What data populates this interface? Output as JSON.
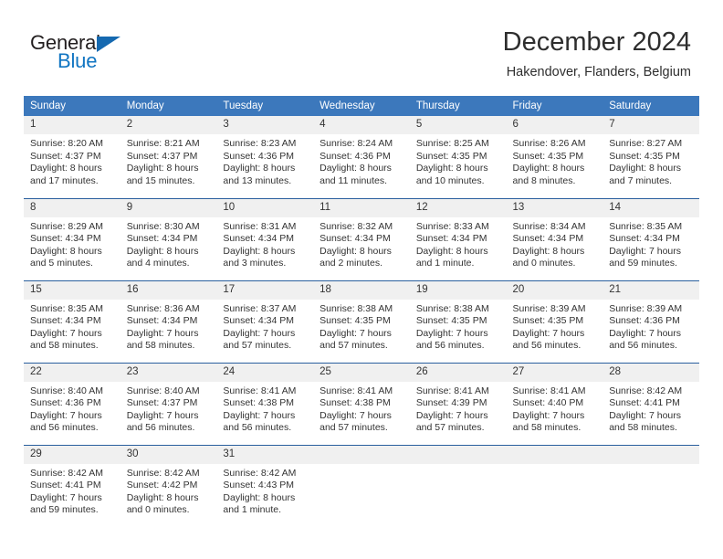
{
  "logo": {
    "word1": "General",
    "word2": "Blue",
    "accent_color": "#1175c2"
  },
  "header": {
    "title": "December 2024",
    "subtitle": "Hakendover, Flanders, Belgium",
    "header_bg": "#3c78bc"
  },
  "calendar": {
    "weekdays": [
      "Sunday",
      "Monday",
      "Tuesday",
      "Wednesday",
      "Thursday",
      "Friday",
      "Saturday"
    ],
    "weeks": [
      [
        {
          "day": "1",
          "sunrise": "Sunrise: 8:20 AM",
          "sunset": "Sunset: 4:37 PM",
          "daylight1": "Daylight: 8 hours",
          "daylight2": "and 17 minutes."
        },
        {
          "day": "2",
          "sunrise": "Sunrise: 8:21 AM",
          "sunset": "Sunset: 4:37 PM",
          "daylight1": "Daylight: 8 hours",
          "daylight2": "and 15 minutes."
        },
        {
          "day": "3",
          "sunrise": "Sunrise: 8:23 AM",
          "sunset": "Sunset: 4:36 PM",
          "daylight1": "Daylight: 8 hours",
          "daylight2": "and 13 minutes."
        },
        {
          "day": "4",
          "sunrise": "Sunrise: 8:24 AM",
          "sunset": "Sunset: 4:36 PM",
          "daylight1": "Daylight: 8 hours",
          "daylight2": "and 11 minutes."
        },
        {
          "day": "5",
          "sunrise": "Sunrise: 8:25 AM",
          "sunset": "Sunset: 4:35 PM",
          "daylight1": "Daylight: 8 hours",
          "daylight2": "and 10 minutes."
        },
        {
          "day": "6",
          "sunrise": "Sunrise: 8:26 AM",
          "sunset": "Sunset: 4:35 PM",
          "daylight1": "Daylight: 8 hours",
          "daylight2": "and 8 minutes."
        },
        {
          "day": "7",
          "sunrise": "Sunrise: 8:27 AM",
          "sunset": "Sunset: 4:35 PM",
          "daylight1": "Daylight: 8 hours",
          "daylight2": "and 7 minutes."
        }
      ],
      [
        {
          "day": "8",
          "sunrise": "Sunrise: 8:29 AM",
          "sunset": "Sunset: 4:34 PM",
          "daylight1": "Daylight: 8 hours",
          "daylight2": "and 5 minutes."
        },
        {
          "day": "9",
          "sunrise": "Sunrise: 8:30 AM",
          "sunset": "Sunset: 4:34 PM",
          "daylight1": "Daylight: 8 hours",
          "daylight2": "and 4 minutes."
        },
        {
          "day": "10",
          "sunrise": "Sunrise: 8:31 AM",
          "sunset": "Sunset: 4:34 PM",
          "daylight1": "Daylight: 8 hours",
          "daylight2": "and 3 minutes."
        },
        {
          "day": "11",
          "sunrise": "Sunrise: 8:32 AM",
          "sunset": "Sunset: 4:34 PM",
          "daylight1": "Daylight: 8 hours",
          "daylight2": "and 2 minutes."
        },
        {
          "day": "12",
          "sunrise": "Sunrise: 8:33 AM",
          "sunset": "Sunset: 4:34 PM",
          "daylight1": "Daylight: 8 hours",
          "daylight2": "and 1 minute."
        },
        {
          "day": "13",
          "sunrise": "Sunrise: 8:34 AM",
          "sunset": "Sunset: 4:34 PM",
          "daylight1": "Daylight: 8 hours",
          "daylight2": "and 0 minutes."
        },
        {
          "day": "14",
          "sunrise": "Sunrise: 8:35 AM",
          "sunset": "Sunset: 4:34 PM",
          "daylight1": "Daylight: 7 hours",
          "daylight2": "and 59 minutes."
        }
      ],
      [
        {
          "day": "15",
          "sunrise": "Sunrise: 8:35 AM",
          "sunset": "Sunset: 4:34 PM",
          "daylight1": "Daylight: 7 hours",
          "daylight2": "and 58 minutes."
        },
        {
          "day": "16",
          "sunrise": "Sunrise: 8:36 AM",
          "sunset": "Sunset: 4:34 PM",
          "daylight1": "Daylight: 7 hours",
          "daylight2": "and 58 minutes."
        },
        {
          "day": "17",
          "sunrise": "Sunrise: 8:37 AM",
          "sunset": "Sunset: 4:34 PM",
          "daylight1": "Daylight: 7 hours",
          "daylight2": "and 57 minutes."
        },
        {
          "day": "18",
          "sunrise": "Sunrise: 8:38 AM",
          "sunset": "Sunset: 4:35 PM",
          "daylight1": "Daylight: 7 hours",
          "daylight2": "and 57 minutes."
        },
        {
          "day": "19",
          "sunrise": "Sunrise: 8:38 AM",
          "sunset": "Sunset: 4:35 PM",
          "daylight1": "Daylight: 7 hours",
          "daylight2": "and 56 minutes."
        },
        {
          "day": "20",
          "sunrise": "Sunrise: 8:39 AM",
          "sunset": "Sunset: 4:35 PM",
          "daylight1": "Daylight: 7 hours",
          "daylight2": "and 56 minutes."
        },
        {
          "day": "21",
          "sunrise": "Sunrise: 8:39 AM",
          "sunset": "Sunset: 4:36 PM",
          "daylight1": "Daylight: 7 hours",
          "daylight2": "and 56 minutes."
        }
      ],
      [
        {
          "day": "22",
          "sunrise": "Sunrise: 8:40 AM",
          "sunset": "Sunset: 4:36 PM",
          "daylight1": "Daylight: 7 hours",
          "daylight2": "and 56 minutes."
        },
        {
          "day": "23",
          "sunrise": "Sunrise: 8:40 AM",
          "sunset": "Sunset: 4:37 PM",
          "daylight1": "Daylight: 7 hours",
          "daylight2": "and 56 minutes."
        },
        {
          "day": "24",
          "sunrise": "Sunrise: 8:41 AM",
          "sunset": "Sunset: 4:38 PM",
          "daylight1": "Daylight: 7 hours",
          "daylight2": "and 56 minutes."
        },
        {
          "day": "25",
          "sunrise": "Sunrise: 8:41 AM",
          "sunset": "Sunset: 4:38 PM",
          "daylight1": "Daylight: 7 hours",
          "daylight2": "and 57 minutes."
        },
        {
          "day": "26",
          "sunrise": "Sunrise: 8:41 AM",
          "sunset": "Sunset: 4:39 PM",
          "daylight1": "Daylight: 7 hours",
          "daylight2": "and 57 minutes."
        },
        {
          "day": "27",
          "sunrise": "Sunrise: 8:41 AM",
          "sunset": "Sunset: 4:40 PM",
          "daylight1": "Daylight: 7 hours",
          "daylight2": "and 58 minutes."
        },
        {
          "day": "28",
          "sunrise": "Sunrise: 8:42 AM",
          "sunset": "Sunset: 4:41 PM",
          "daylight1": "Daylight: 7 hours",
          "daylight2": "and 58 minutes."
        }
      ],
      [
        {
          "day": "29",
          "sunrise": "Sunrise: 8:42 AM",
          "sunset": "Sunset: 4:41 PM",
          "daylight1": "Daylight: 7 hours",
          "daylight2": "and 59 minutes."
        },
        {
          "day": "30",
          "sunrise": "Sunrise: 8:42 AM",
          "sunset": "Sunset: 4:42 PM",
          "daylight1": "Daylight: 8 hours",
          "daylight2": "and 0 minutes."
        },
        {
          "day": "31",
          "sunrise": "Sunrise: 8:42 AM",
          "sunset": "Sunset: 4:43 PM",
          "daylight1": "Daylight: 8 hours",
          "daylight2": "and 1 minute."
        },
        {
          "day": "",
          "sunrise": "",
          "sunset": "",
          "daylight1": "",
          "daylight2": ""
        },
        {
          "day": "",
          "sunrise": "",
          "sunset": "",
          "daylight1": "",
          "daylight2": ""
        },
        {
          "day": "",
          "sunrise": "",
          "sunset": "",
          "daylight1": "",
          "daylight2": ""
        },
        {
          "day": "",
          "sunrise": "",
          "sunset": "",
          "daylight1": "",
          "daylight2": ""
        }
      ]
    ]
  }
}
